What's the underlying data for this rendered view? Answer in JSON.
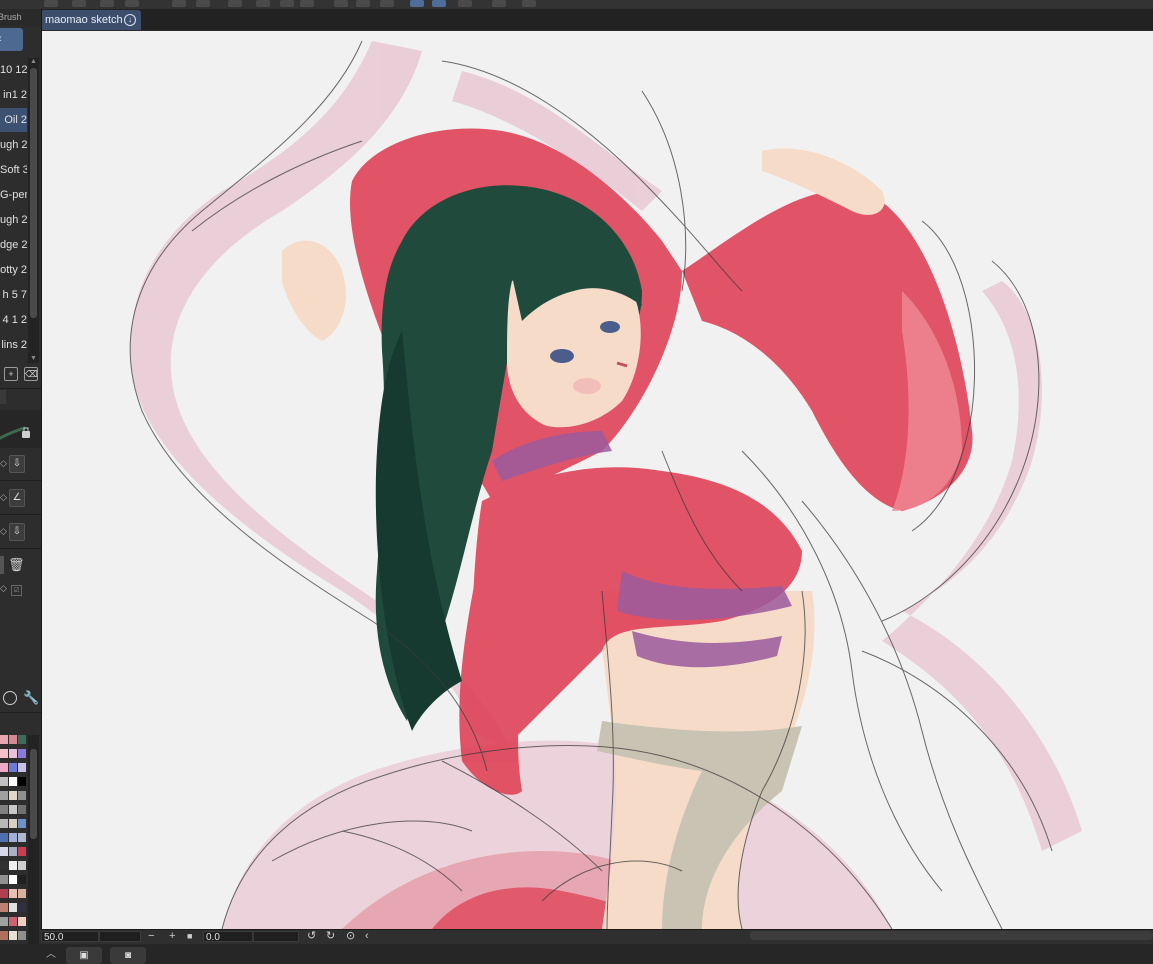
{
  "document": {
    "tab_title": "maomao sketch",
    "tab_icon": "download-circle-icon"
  },
  "brush_panel": {
    "header": "Brush",
    "items": [
      {
        "label": "10 12",
        "selected": false
      },
      {
        "label": "in1 2",
        "selected": false
      },
      {
        "label": "Oil 2",
        "selected": true
      },
      {
        "label": "ugh 2",
        "selected": false
      },
      {
        "label": "Soft 3",
        "selected": false
      },
      {
        "label": "G-pen",
        "selected": false
      },
      {
        "label": "ugh 2",
        "selected": false
      },
      {
        "label": "dge 2",
        "selected": false
      },
      {
        "label": "otty 2",
        "selected": false
      },
      {
        "label": "h 5 7",
        "selected": false
      },
      {
        "label": "4 1 2",
        "selected": false
      },
      {
        "label": "lins 2",
        "selected": false
      }
    ]
  },
  "status_bar": {
    "zoom": "50.0",
    "rotation": "0.0",
    "zoom_out": "−",
    "zoom_in": "+",
    "fit": "■",
    "rotate_left": "↺",
    "rotate_right": "↻",
    "reset": "⊙",
    "collapse": "‹"
  },
  "bottom_bar": {
    "scroll_up": "︿"
  },
  "colors": {
    "accent": "#4d6891",
    "canvas_bg": "#f1f1f1",
    "hair": "#1f4a3c",
    "robe": "#e0465b",
    "sash_pink": "#e9c6d1",
    "skin": "#f6dcc8",
    "sash_purple": "#9a5a9e",
    "belt": "#c9c3b3"
  },
  "palette": [
    [
      "#e8a6b0",
      "#d88890",
      "#3f6c5a"
    ],
    [
      "#f4c2c8",
      "#e8c0d8",
      "#8c7ad8"
    ],
    [
      "#f0a8c8",
      "#6d7bd8",
      "#c8c0e8"
    ],
    [
      "#c0c0c0",
      "#ffffff",
      "#000000"
    ],
    [
      "#a0a0a0",
      "#e0d8c8",
      "#909090"
    ],
    [
      "#808080",
      "#c8c8c8",
      "#707070"
    ],
    [
      "#b8b8b8",
      "#d8d0c0",
      "#7090c8"
    ],
    [
      "#5070b0",
      "#9fb0d8",
      "#b0b8d0"
    ],
    [
      "#d8d8e8",
      "#a8b0c8",
      "#c84050"
    ],
    [
      "#303030",
      "#f0f0f0",
      "#d0d0d0"
    ],
    [
      "#909090",
      "#ffffff",
      "#202020"
    ],
    [
      "#b04050",
      "#e8c0b0",
      "#d8b0a0"
    ],
    [
      "#c08070",
      "#e0e0e0",
      "#303040"
    ],
    [
      "#a0a0a0",
      "#d06070",
      "#f0d0c0"
    ],
    [
      "#b07060",
      "#e8e0d0",
      "#909090"
    ],
    [
      "#d8c070",
      "#c0b060",
      "#a0a0a0"
    ]
  ]
}
